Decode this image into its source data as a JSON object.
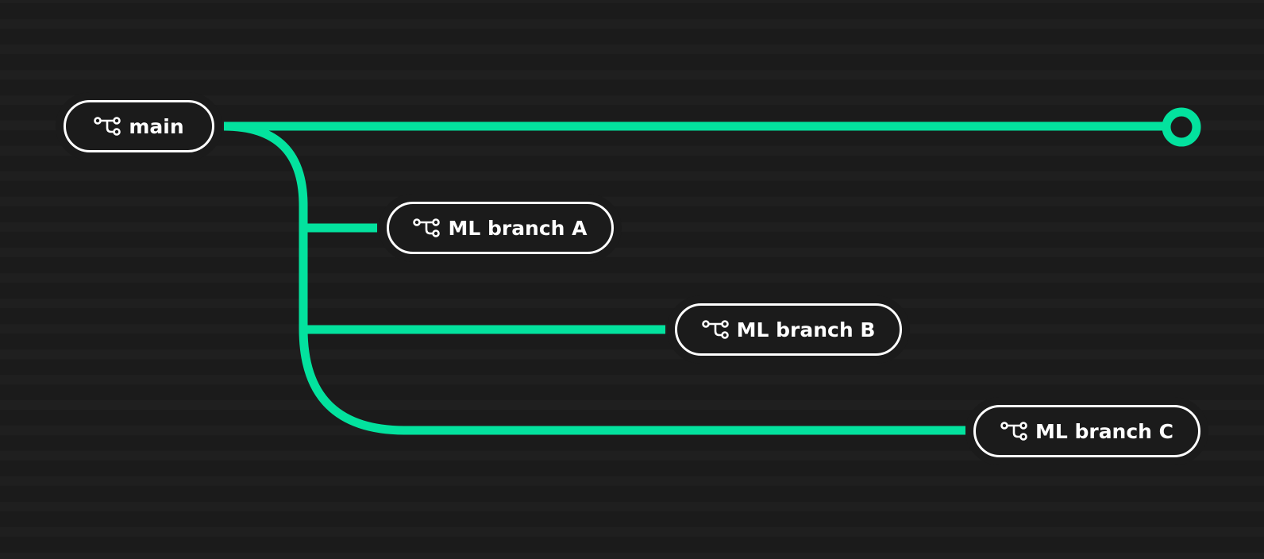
{
  "diagram": {
    "accent_color": "#03e29e",
    "background_color": "#1b1b1b",
    "branch_icon": "git-branch-icon",
    "end_marker": "commit-circle-icon",
    "nodes": [
      {
        "id": "main",
        "label": "main"
      },
      {
        "id": "a",
        "label": "ML branch A",
        "parent": "main"
      },
      {
        "id": "b",
        "label": "ML branch B",
        "parent": "main"
      },
      {
        "id": "c",
        "label": "ML branch C",
        "parent": "main"
      }
    ]
  }
}
